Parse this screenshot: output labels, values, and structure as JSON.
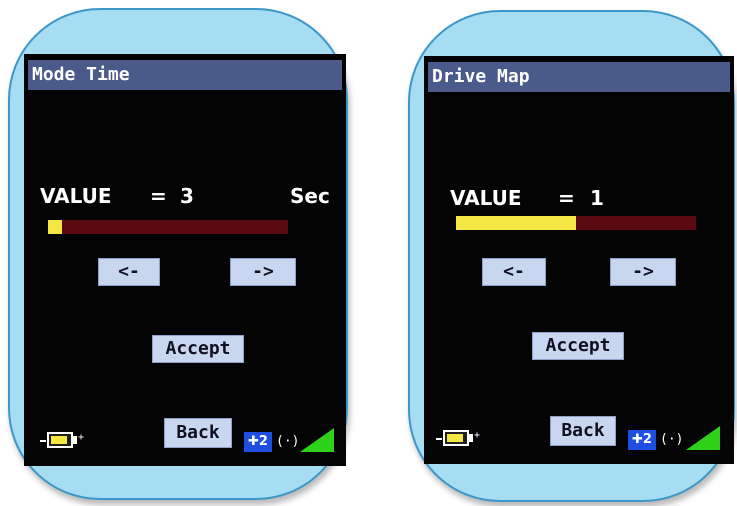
{
  "screens": [
    {
      "title": "Mode Time",
      "value_label": "VALUE",
      "value_equals": "=",
      "value": "3",
      "unit": "Sec",
      "progress_fraction": 0.06,
      "prev_label": "<-",
      "next_label": "->",
      "accept_label": "Accept",
      "back_label": "Back",
      "bt_text": "✚2",
      "antenna_text": "(·)"
    },
    {
      "title": "Drive Map",
      "value_label": "VALUE",
      "value_equals": "=",
      "value": "1",
      "unit": "",
      "progress_fraction": 0.5,
      "prev_label": "<-",
      "next_label": "->",
      "accept_label": "Accept",
      "back_label": "Back",
      "bt_text": "✚2",
      "antenna_text": "(·)"
    }
  ],
  "colors": {
    "bezel": "#a6ddf3",
    "title_bar": "#4a5a8a",
    "bar_fill": "#f4e643",
    "bar_track": "#5a0a10",
    "button": "#c8d6f0",
    "bluetooth": "#1f4fe0",
    "signal": "#2fd21a"
  }
}
